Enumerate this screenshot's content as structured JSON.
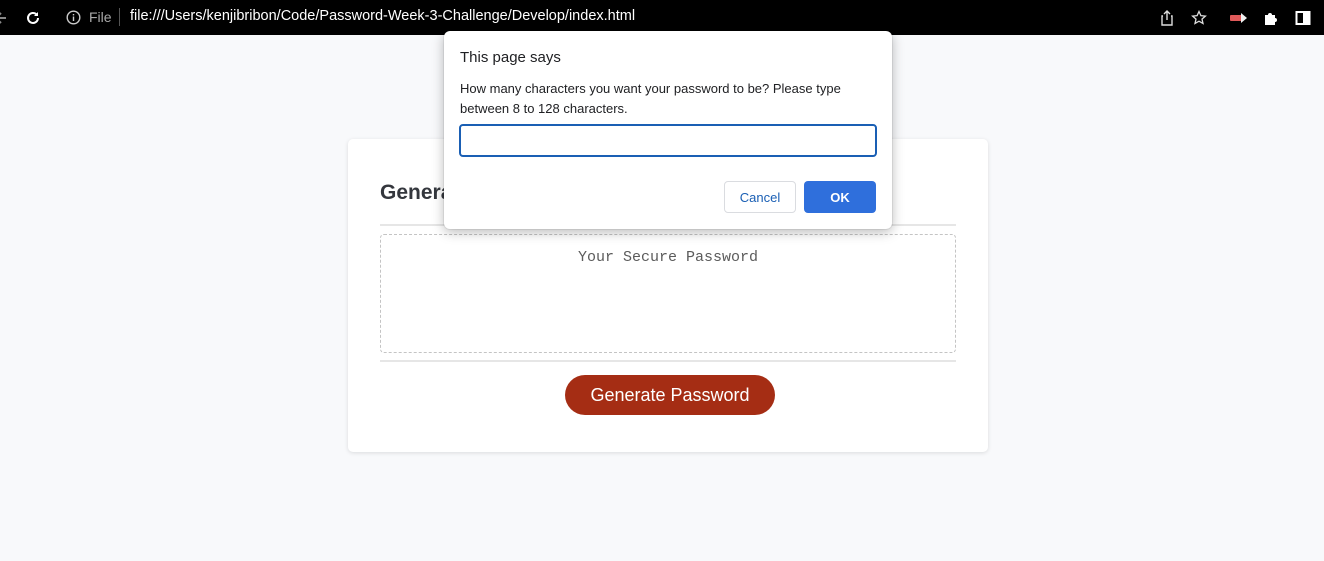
{
  "browser": {
    "scheme_label": "File",
    "url": "file:///Users/kenjibribon/Code/Password-Week-3-Challenge/Develop/index.html",
    "icons": [
      "back-icon",
      "reload-icon",
      "info-icon",
      "share-icon",
      "star-icon",
      "extension-icon",
      "puzzle-icon",
      "side-panel-icon"
    ]
  },
  "page": {
    "title": "Generate a Password",
    "password_placeholder": "Your Secure Password",
    "generate_button_label": "Generate Password",
    "accent_color": "#a52d14"
  },
  "dialog": {
    "title": "This page says",
    "message": "How many characters you want your password to be? Please type between 8 to 128 characters.",
    "input_value": "",
    "cancel_label": "Cancel",
    "ok_label": "OK"
  }
}
